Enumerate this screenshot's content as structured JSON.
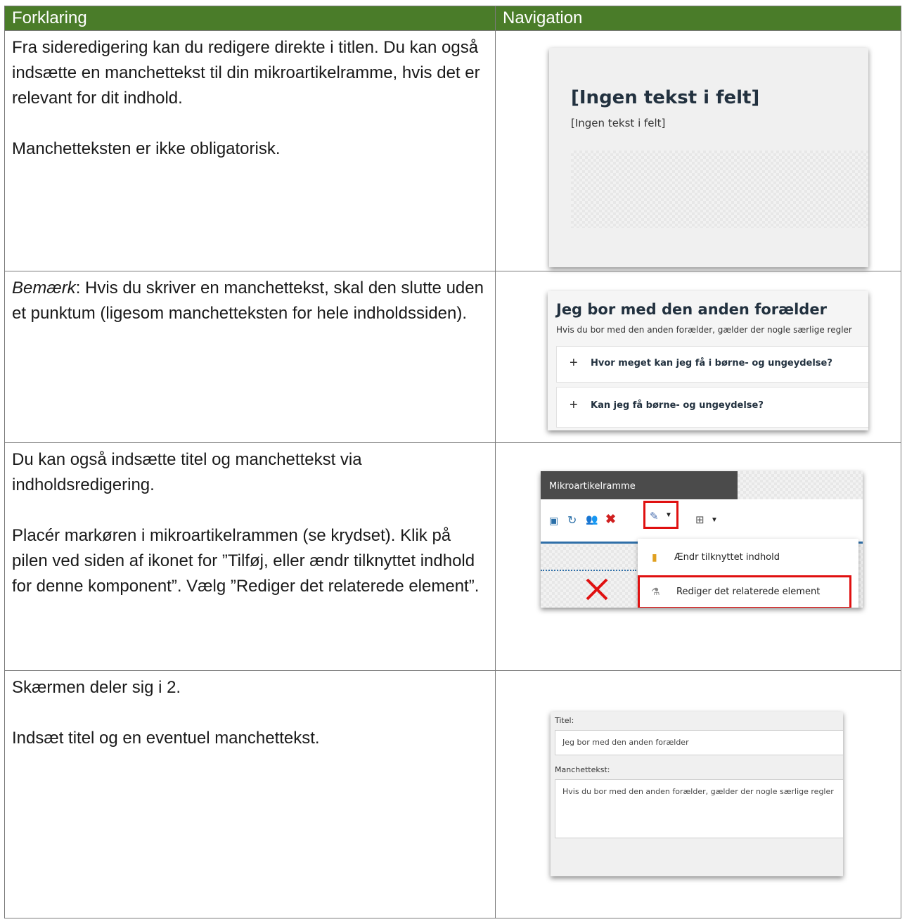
{
  "header": {
    "left": "Forklaring",
    "right": "Navigation"
  },
  "rows": [
    {
      "paragraphs": [
        "Fra sideredigering kan du redigere direkte i titlen. Du kan også indsætte en manchettekst til din mikroartikelramme, hvis det er relevant for dit indhold.",
        "Manchetteksten er ikke obligatorisk."
      ],
      "shot": {
        "title": "[Ingen tekst i felt]",
        "subtitle": "[Ingen tekst i felt]"
      }
    },
    {
      "em_word": "Bemærk",
      "rest": ": Hvis du skriver en manchettekst, skal den slutte uden et punktum (ligesom manchetteksten for hele indholdssiden).",
      "shot": {
        "title": "Jeg bor med den anden forælder",
        "subtitle": "Hvis du bor med den anden forælder, gælder der nogle særlige regler",
        "items": [
          "Hvor meget kan jeg få i børne- og ungeydelse?",
          "Kan jeg få børne- og ungeydelse?"
        ]
      }
    },
    {
      "paragraphs": [
        "Du kan også indsætte titel og manchettekst via indholdsredigering.",
        "Placér markøren i mikroartikelrammen (se krydset). Klik på pilen ved siden af ikonet for ”Tilføj, eller ændr tilknyttet indhold for denne komponent”. Vælg ”Rediger det relaterede element”."
      ],
      "shot": {
        "toolbar_title": "Mikroartikelramme",
        "menu": [
          "Ændr tilknyttet indhold",
          "Rediger det relaterede element"
        ]
      }
    },
    {
      "paragraphs": [
        "Skærmen deler sig i 2.",
        "Indsæt titel og en eventuel manchettekst."
      ],
      "shot": {
        "label_title": "Titel:",
        "value_title": "Jeg bor med den anden forælder",
        "label_manchet": "Manchettekst:",
        "value_manchet": "Hvis du bor med den anden forælder, gælder der nogle særlige regler"
      }
    }
  ],
  "colors": {
    "header_bg": "#4a7c29",
    "highlight": "#e01010"
  }
}
